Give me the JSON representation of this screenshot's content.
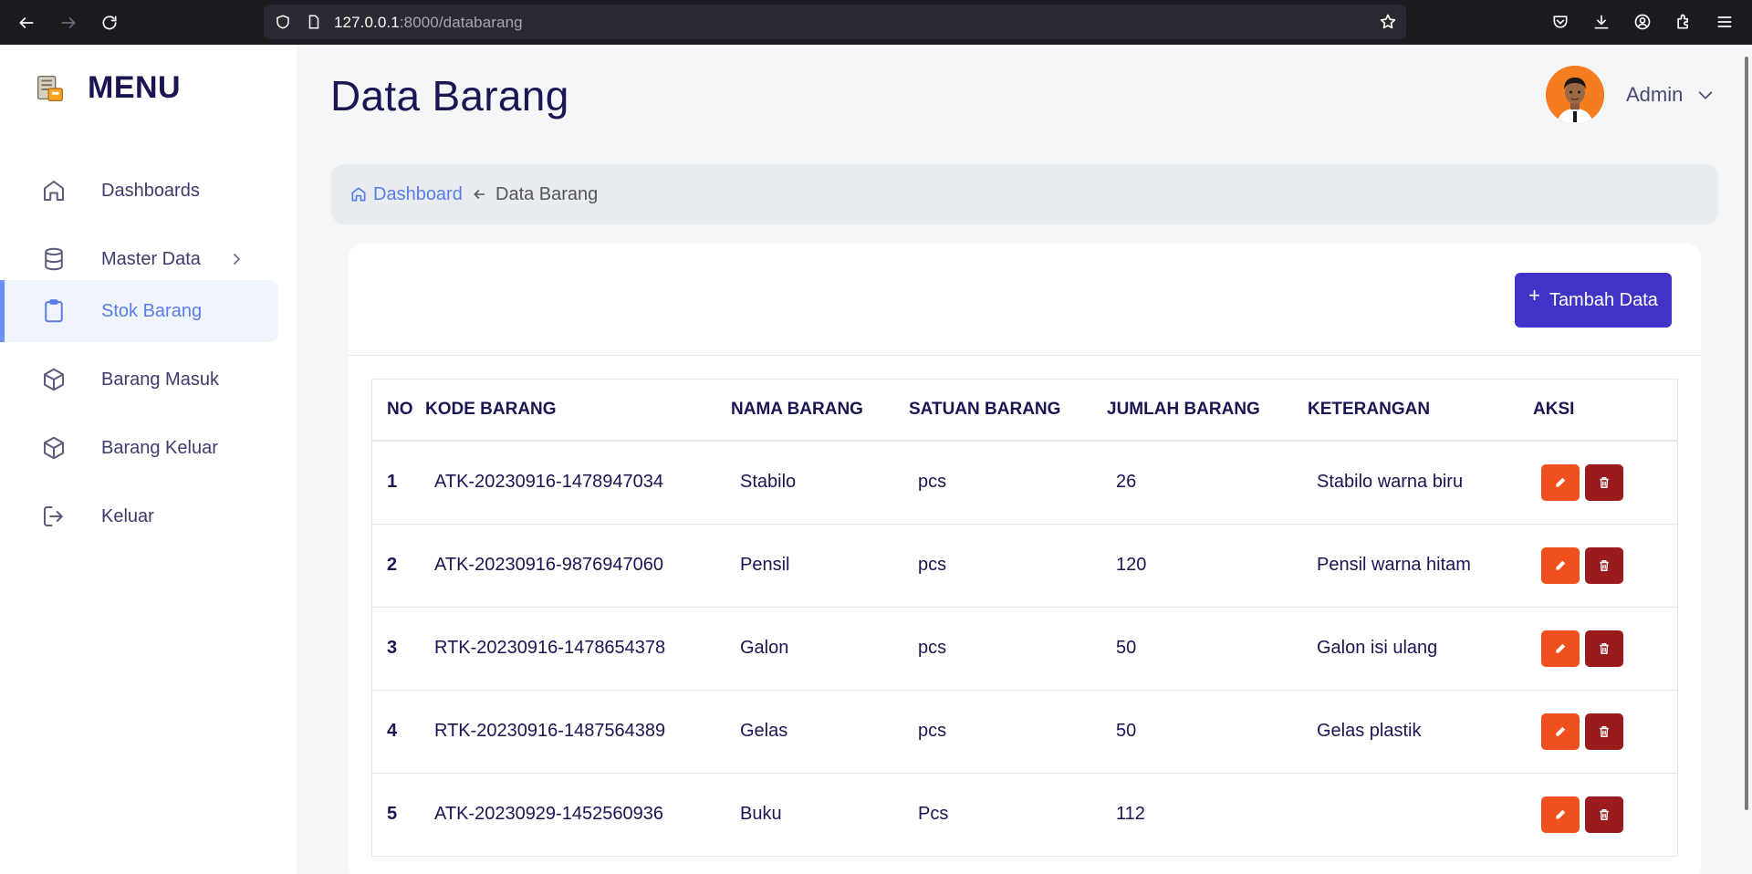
{
  "browser": {
    "url_host": "127.0.0.1",
    "url_rest": ":8000/databarang"
  },
  "sidebar": {
    "brand": "MENU",
    "items": [
      {
        "label": "Dashboards",
        "icon": "home-icon"
      },
      {
        "label": "Master Data",
        "icon": "database-icon"
      },
      {
        "label": "Stok Barang",
        "icon": "clipboard-icon",
        "active": true
      },
      {
        "label": "Barang Masuk",
        "icon": "box-icon"
      },
      {
        "label": "Barang Keluar",
        "icon": "box-icon"
      },
      {
        "label": "Keluar",
        "icon": "logout-icon"
      }
    ]
  },
  "header": {
    "title": "Data Barang",
    "user_name": "Admin"
  },
  "breadcrumb": {
    "home": "Dashboard",
    "current": "Data Barang"
  },
  "card": {
    "add_button": "Tambah Data",
    "add_button_icon": "+"
  },
  "table": {
    "columns": [
      "NO",
      "KODE BARANG",
      "NAMA BARANG",
      "SATUAN BARANG",
      "JUMLAH BARANG",
      "KETERANGAN",
      "AKSI"
    ],
    "rows": [
      {
        "no": "1",
        "kode": "ATK-20230916-1478947034",
        "nama": "Stabilo",
        "satuan": "pcs",
        "jumlah": "26",
        "ket": "Stabilo warna biru"
      },
      {
        "no": "2",
        "kode": "ATK-20230916-9876947060",
        "nama": "Pensil",
        "satuan": "pcs",
        "jumlah": "120",
        "ket": "Pensil warna hitam"
      },
      {
        "no": "3",
        "kode": "RTK-20230916-1478654378",
        "nama": "Galon",
        "satuan": "pcs",
        "jumlah": "50",
        "ket": "Galon isi ulang"
      },
      {
        "no": "4",
        "kode": "RTK-20230916-1487564389",
        "nama": "Gelas",
        "satuan": "pcs",
        "jumlah": "50",
        "ket": "Gelas plastik"
      },
      {
        "no": "5",
        "kode": "ATK-20230929-1452560936",
        "nama": "Buku",
        "satuan": "Pcs",
        "jumlah": "112",
        "ket": ""
      }
    ]
  },
  "colors": {
    "accent": "#5a7de8",
    "primary_button": "#4033c5",
    "edit_button": "#f0501d",
    "delete_button": "#991b1b",
    "avatar_bg": "#f57c1f"
  }
}
